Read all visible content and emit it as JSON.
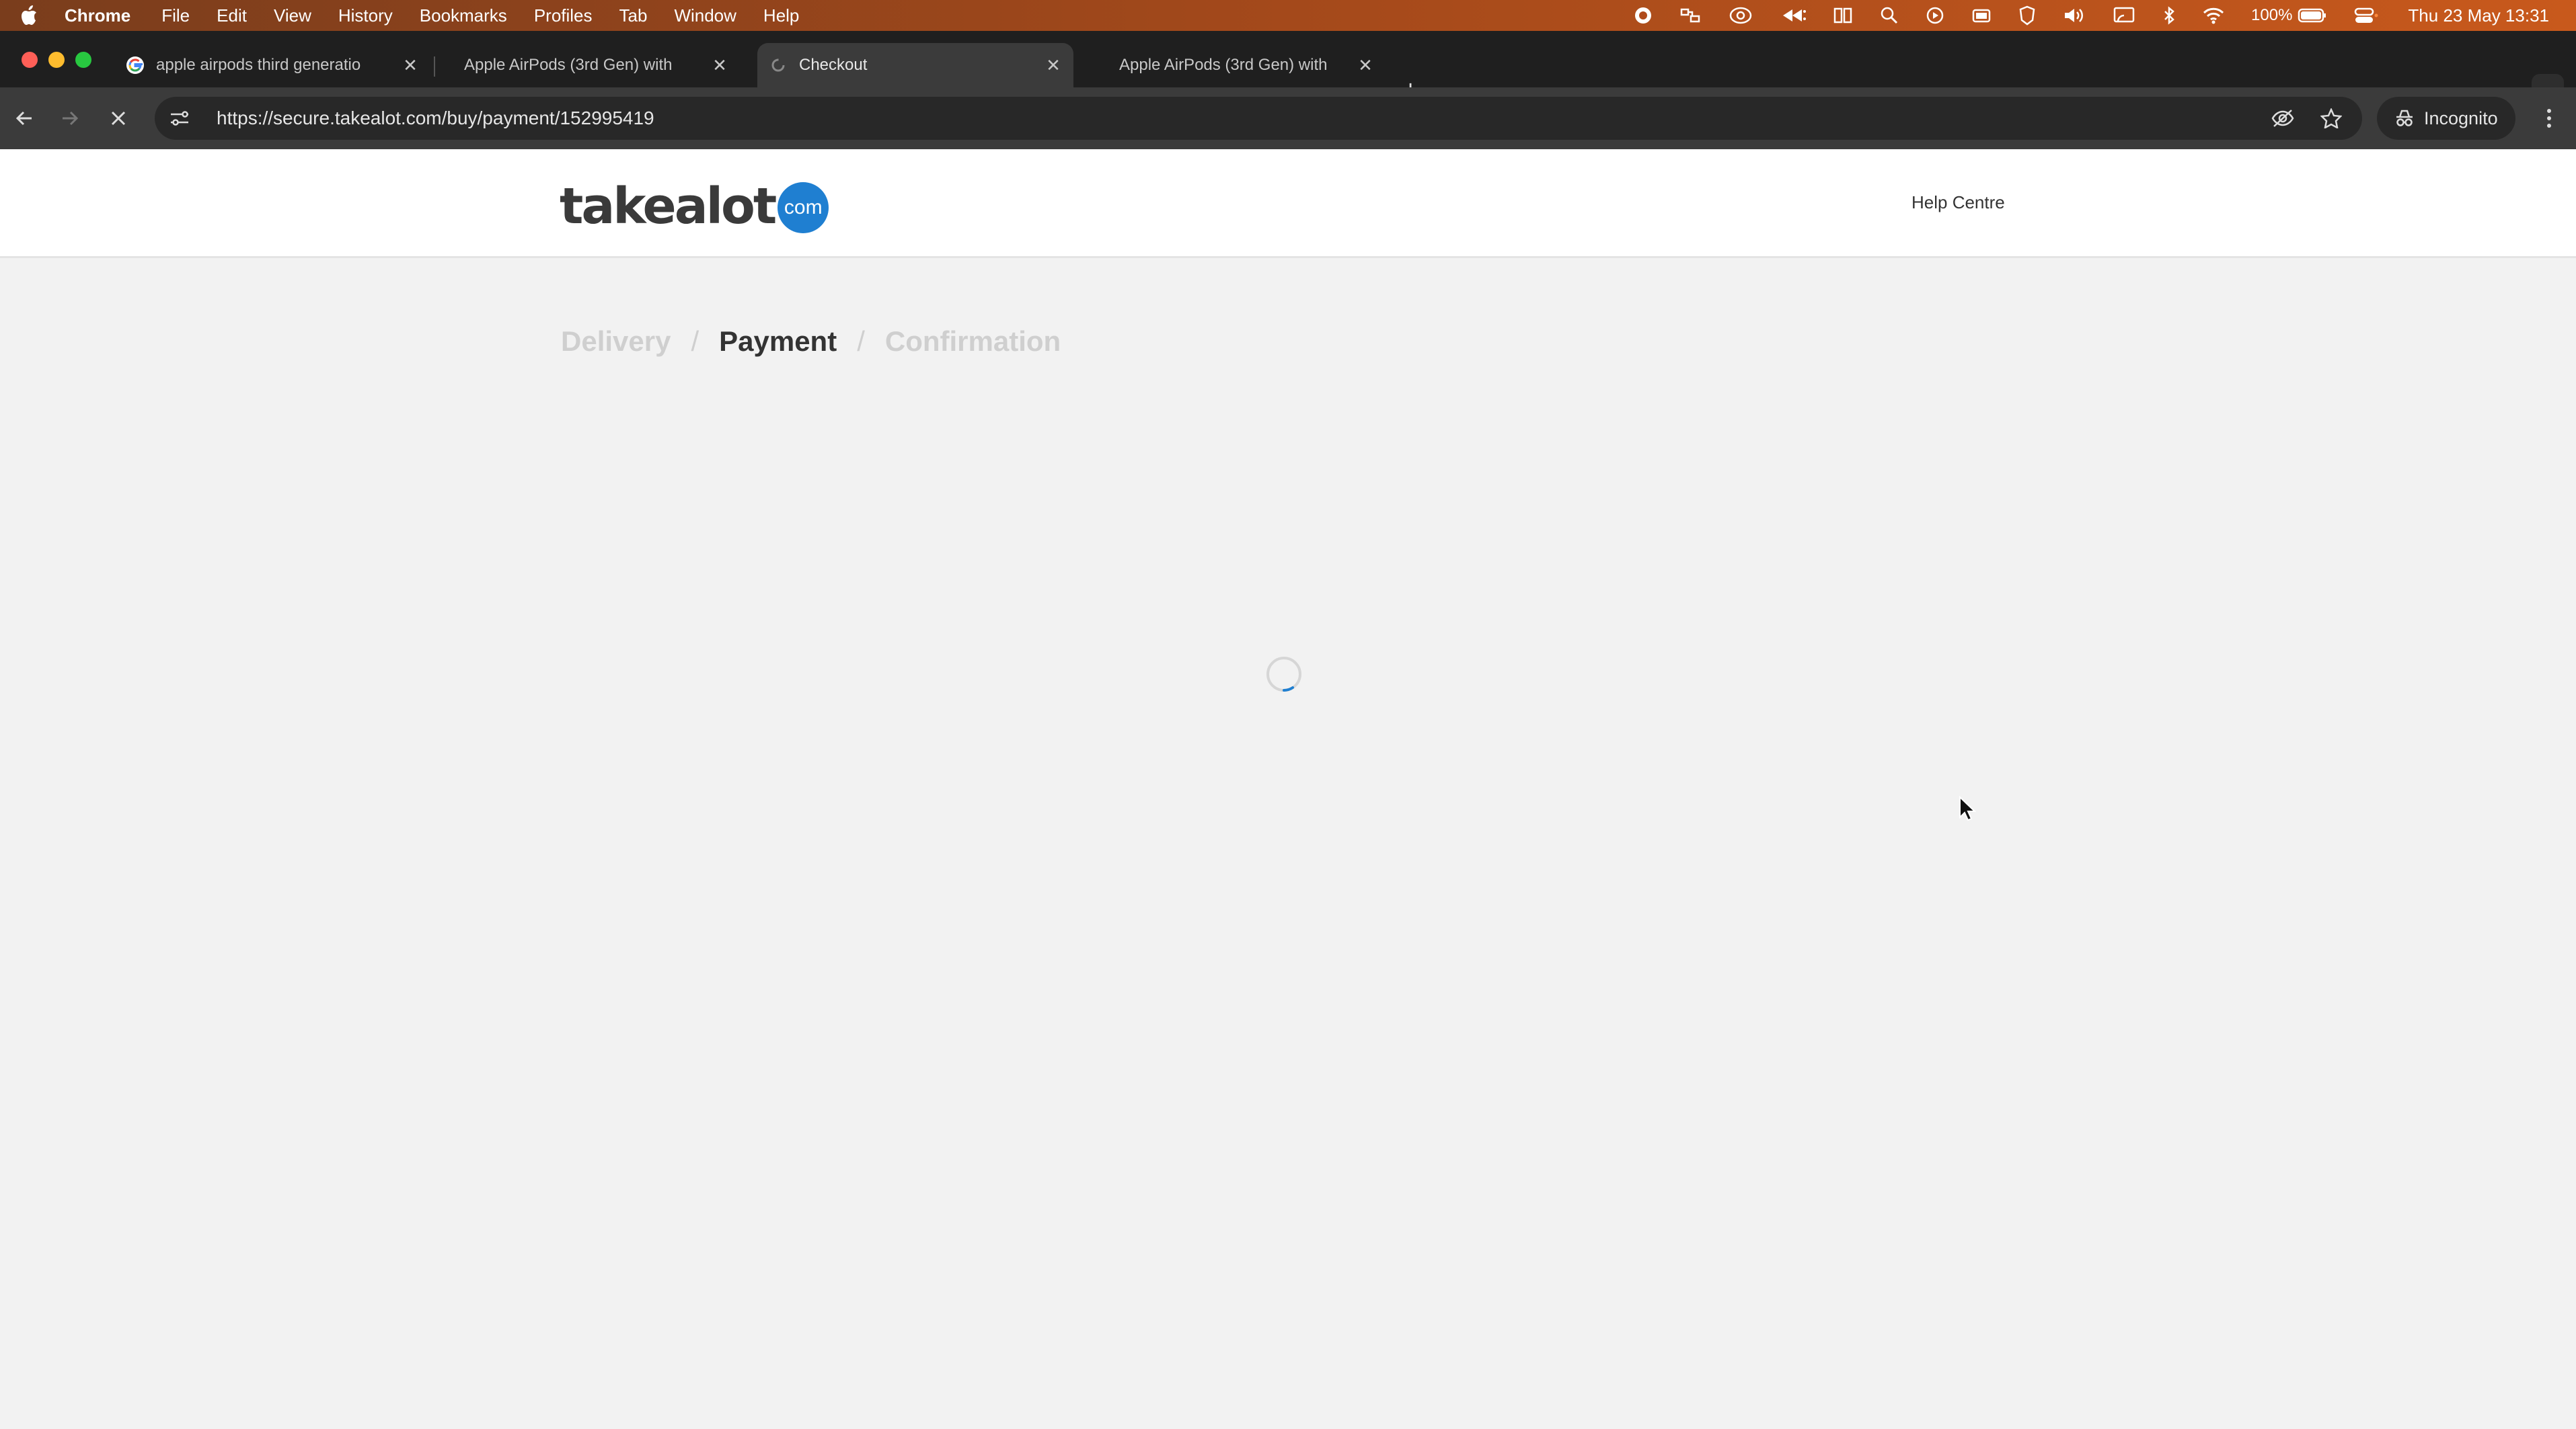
{
  "menubar": {
    "app_name": "Chrome",
    "items": [
      "File",
      "Edit",
      "View",
      "History",
      "Bookmarks",
      "Profiles",
      "Tab",
      "Window",
      "Help"
    ],
    "battery": "100%",
    "clock": "Thu 23 May  13:31"
  },
  "tabs": [
    {
      "title": "apple airpods third generatio",
      "favicon": "google-icon"
    },
    {
      "title": "Apple AirPods (3rd Gen) with",
      "favicon": "none"
    },
    {
      "title": "Checkout",
      "favicon": "loading-icon",
      "active": true
    },
    {
      "title": "Apple AirPods (3rd Gen) with",
      "favicon": "none"
    }
  ],
  "toolbar": {
    "url": "https://secure.takealot.com/buy/payment/152995419",
    "incognito_label": "Incognito"
  },
  "site": {
    "logo_word": "takealot",
    "logo_suffix": "com",
    "help_label": "Help Centre"
  },
  "steps": {
    "delivery": "Delivery",
    "payment": "Payment",
    "confirmation": "Confirmation",
    "separator": "/"
  },
  "colors": {
    "brand_blue": "#1f7fd1",
    "menubar": "#a4491b",
    "page_bg": "#f2f2f2"
  }
}
